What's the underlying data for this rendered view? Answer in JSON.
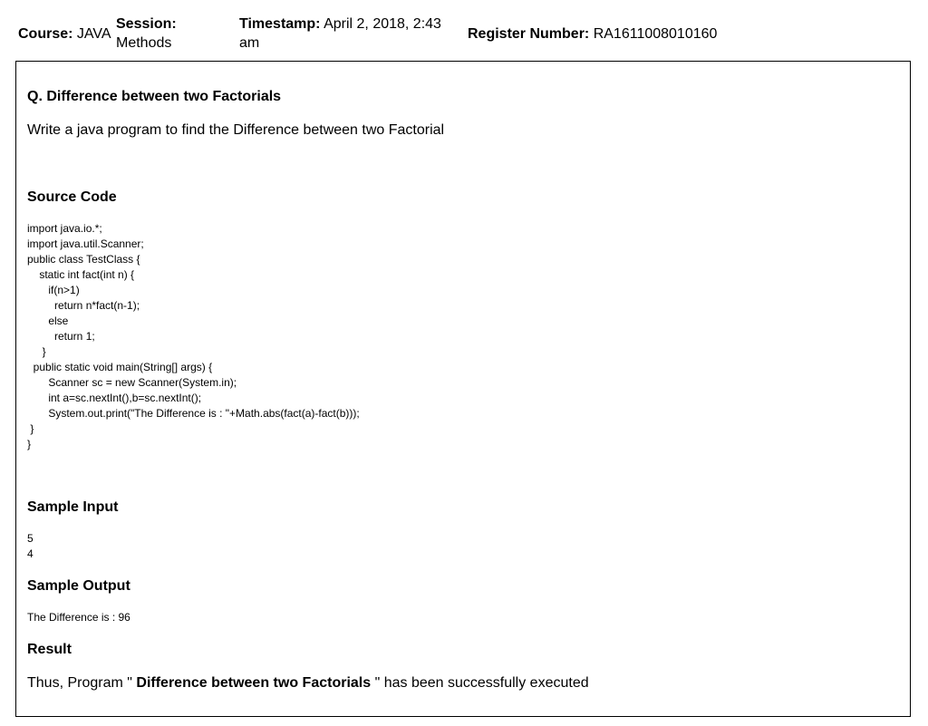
{
  "header": {
    "course_label": "Course:",
    "course_value": "JAVA",
    "session_label": "Session:",
    "session_value": "Methods",
    "timestamp_label": "Timestamp:",
    "timestamp_value": "April 2, 2018, 2:43 am",
    "register_label": "Register Number:",
    "register_value": "RA1611008010160"
  },
  "question": {
    "title": "Q. Difference between two Factorials",
    "text": "Write a java program to find the Difference between two Factorial"
  },
  "source": {
    "heading": "Source Code",
    "code": "import java.io.*;\nimport java.util.Scanner;\npublic class TestClass {\n    static int fact(int n) {\n       if(n>1)\n         return n*fact(n-1);\n       else\n         return 1;\n     }\n  public static void main(String[] args) {\n       Scanner sc = new Scanner(System.in);\n       int a=sc.nextInt(),b=sc.nextInt();\n       System.out.print(\"The Difference is : \"+Math.abs(fact(a)-fact(b)));\n }\n}"
  },
  "sample_input": {
    "heading": "Sample Input",
    "text": "5\n4"
  },
  "sample_output": {
    "heading": "Sample Output",
    "text": "The Difference is : 96"
  },
  "result": {
    "heading": "Result",
    "prefix": "Thus, Program \" ",
    "program_name": "Difference between two Factorials",
    "suffix": " \" has been successfully executed"
  }
}
